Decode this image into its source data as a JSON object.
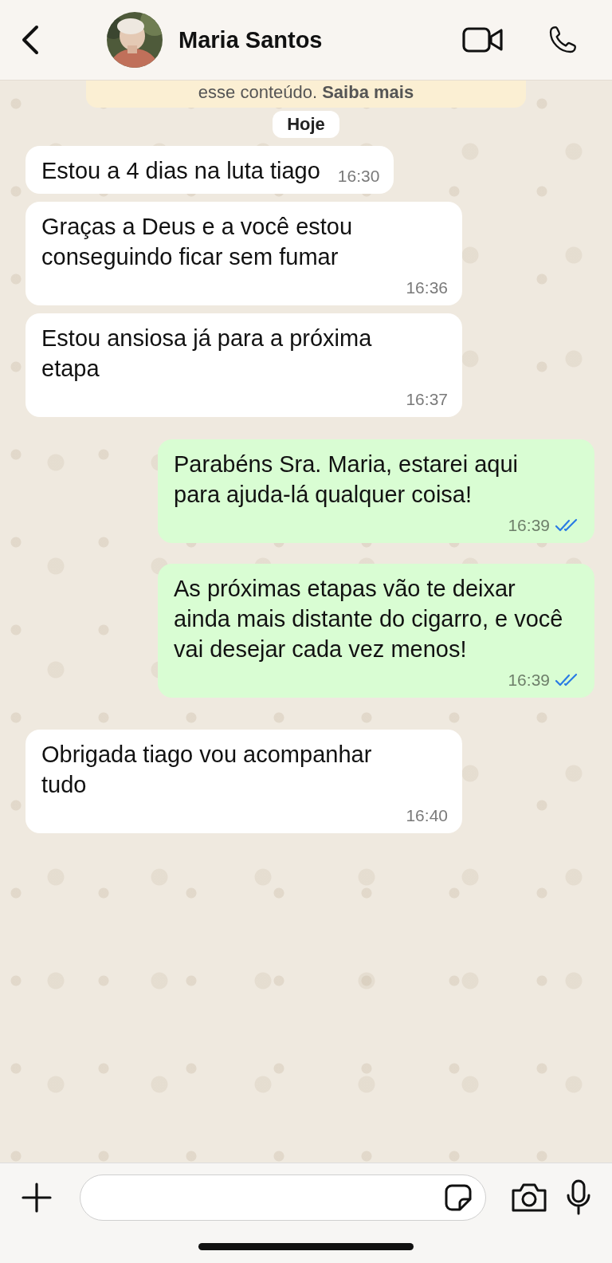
{
  "header": {
    "contact_name": "Maria Santos"
  },
  "banner": {
    "text": "esse conteúdo. **Saiba mais**"
  },
  "date_chip": "Hoje",
  "messages": [
    {
      "kind": "incoming",
      "text": "Estou a 4 dias na luta tiago",
      "time": "16:30"
    },
    {
      "kind": "incoming",
      "text": "Graças a Deus e a você estou conseguindo ficar sem fumar",
      "time": "16:36"
    },
    {
      "kind": "incoming",
      "text": "Estou ansiosa já para a próxima etapa",
      "time": "16:37"
    },
    {
      "kind": "outgoing",
      "text": "Parabéns Sra. Maria, estarei aqui para ajuda-lá qualquer coisa!",
      "time": "16:39",
      "read": true
    },
    {
      "kind": "outgoing",
      "text": "As próximas etapas vão te deixar ainda mais distante do cigarro, e você vai desejar cada vez menos!",
      "time": "16:39",
      "read": true
    },
    {
      "kind": "incoming",
      "text": "Obrigada tiago vou acompanhar tudo",
      "time": "16:40"
    }
  ]
}
